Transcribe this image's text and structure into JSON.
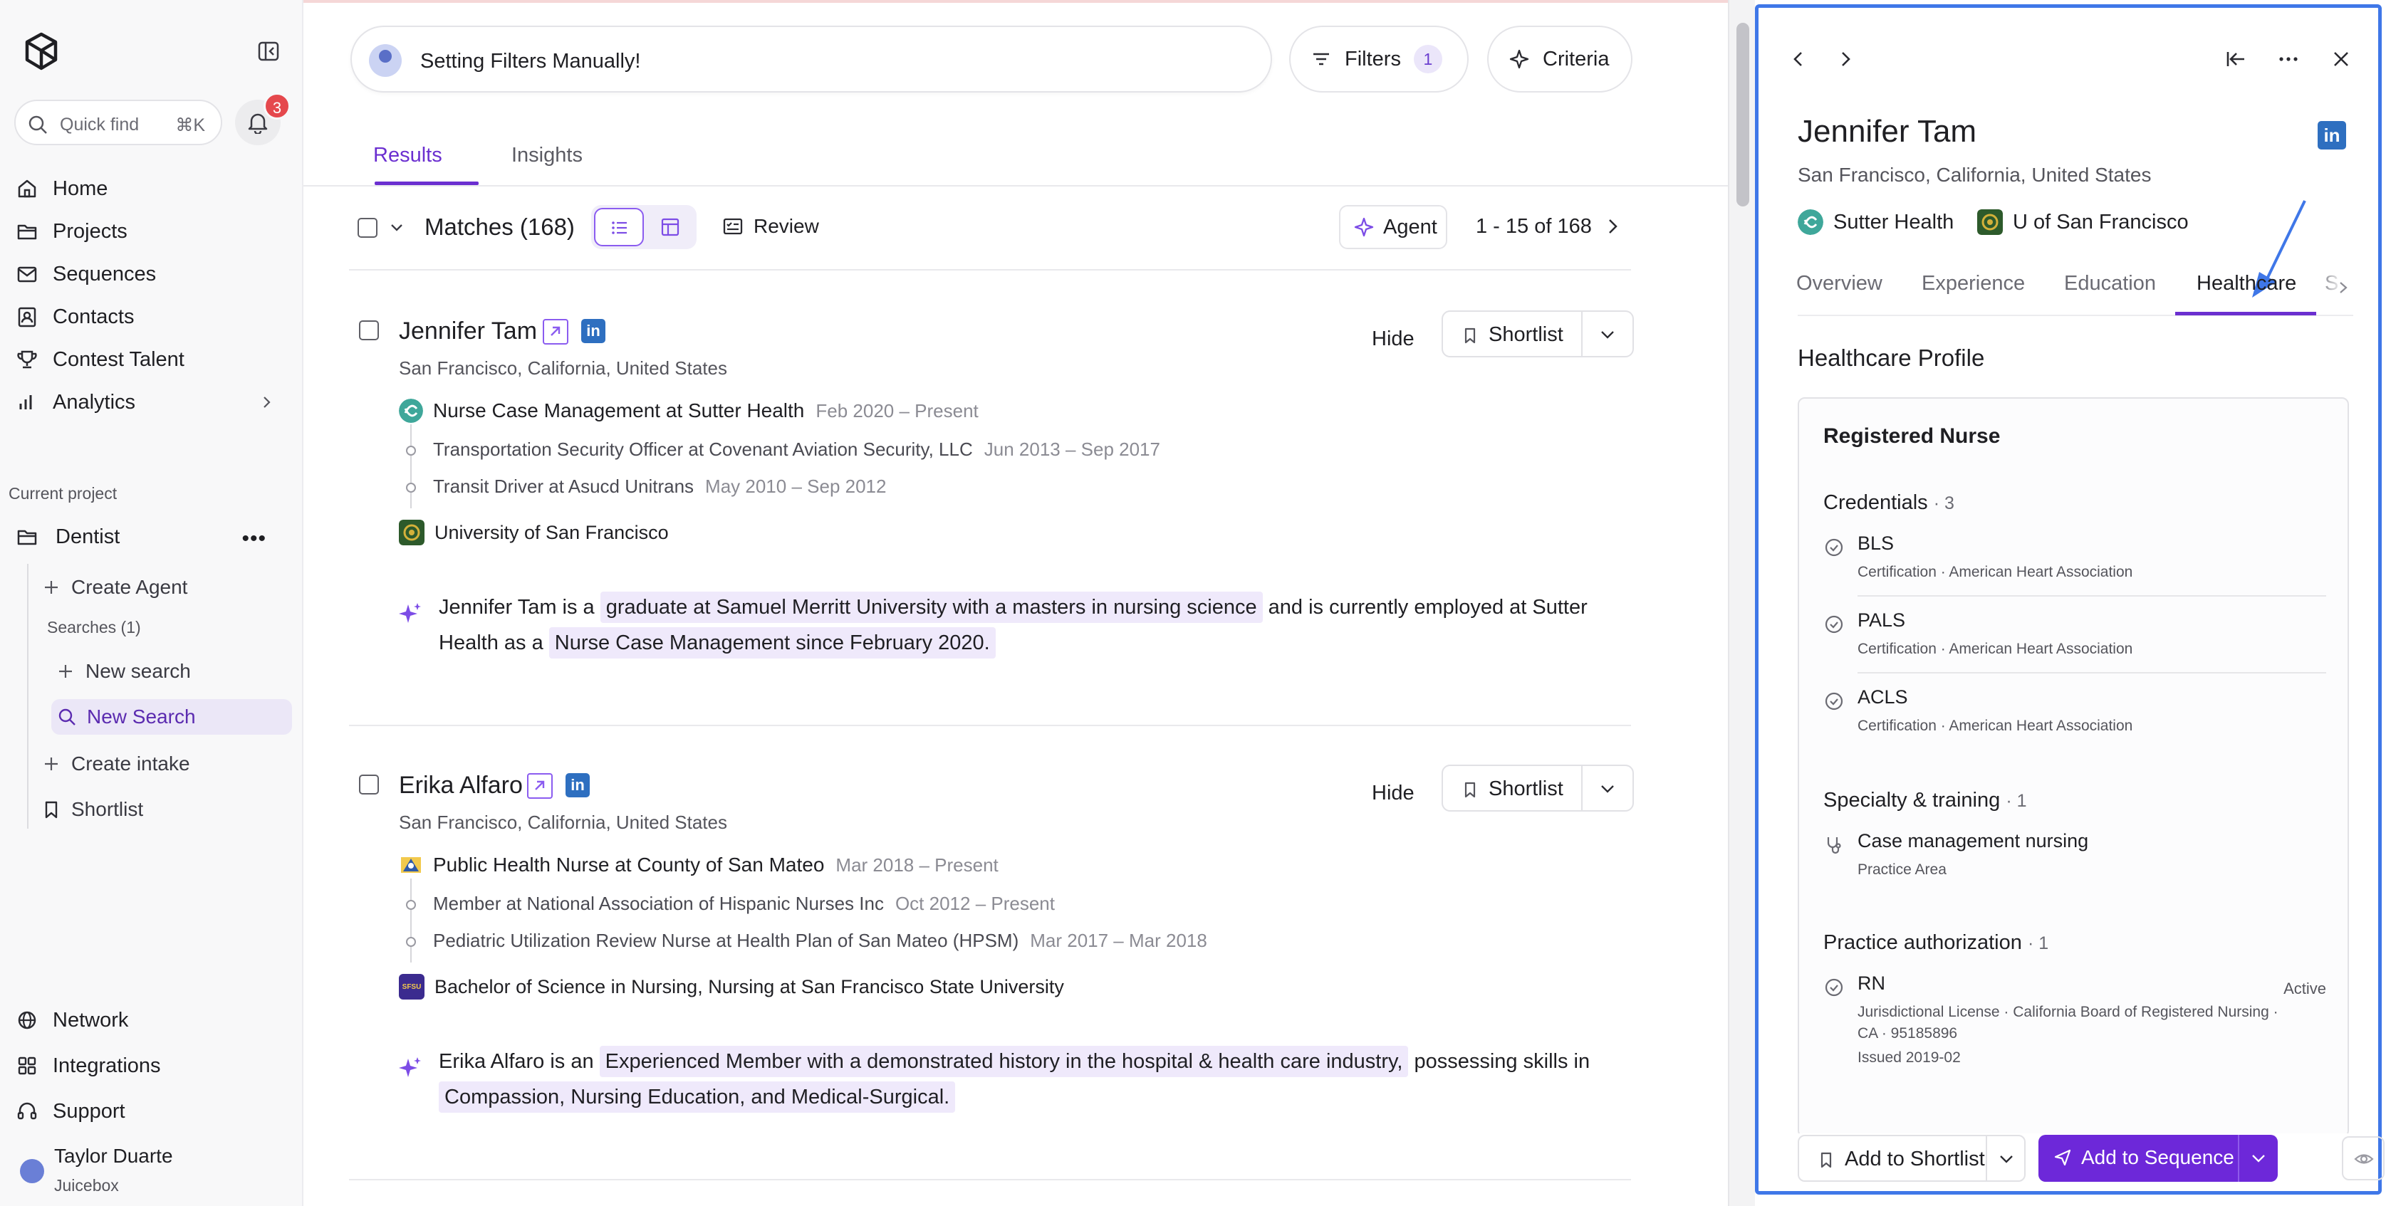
{
  "sidebar": {
    "quick_find": {
      "label": "Quick find",
      "shortcut": "⌘K"
    },
    "notifications": {
      "count": "3"
    },
    "nav": [
      {
        "label": "Home",
        "icon": "home-icon"
      },
      {
        "label": "Projects",
        "icon": "folder-icon"
      },
      {
        "label": "Sequences",
        "icon": "mail-icon"
      },
      {
        "label": "Contacts",
        "icon": "contacts-icon"
      },
      {
        "label": "Contest Talent",
        "icon": "trophy-icon"
      },
      {
        "label": "Analytics",
        "icon": "chart-icon"
      }
    ],
    "current_project_label": "Current project",
    "project_name": "Dentist",
    "create_agent": "Create Agent",
    "searches_label": "Searches (1)",
    "new_search_action": "New search",
    "new_search_item": "New Search",
    "create_intake": "Create intake",
    "shortlist": "Shortlist",
    "bottom_nav": [
      {
        "label": "Network",
        "icon": "globe-icon"
      },
      {
        "label": "Integrations",
        "icon": "grid-icon"
      },
      {
        "label": "Support",
        "icon": "headset-icon"
      }
    ],
    "user": {
      "name": "Taylor Duarte",
      "org": "Juicebox"
    }
  },
  "header": {
    "search_text": "Setting Filters Manually!",
    "filters_label": "Filters",
    "filters_count": "1",
    "criteria_label": "Criteria"
  },
  "tabs": [
    {
      "label": "Results"
    },
    {
      "label": "Insights"
    }
  ],
  "toolbar": {
    "matches": "Matches (168)",
    "review": "Review",
    "agent": "Agent",
    "pager": "1 - 15 of 168"
  },
  "results": [
    {
      "name": "Jennifer Tam",
      "location": "San Francisco, California, United States",
      "hide": "Hide",
      "shortlist": "Shortlist",
      "current_job": {
        "title": "Nurse Case Management at Sutter Health",
        "dates": "Feb 2020 – Present"
      },
      "past_jobs": [
        {
          "title": "Transportation Security Officer at Covenant Aviation Security, LLC",
          "dates": "Jun 2013 – Sep 2017"
        },
        {
          "title": "Transit Driver at Asucd Unitrans",
          "dates": "May 2010 – Sep 2012"
        }
      ],
      "education": "University of San Francisco",
      "summary": {
        "p1": "Jennifer Tam is a ",
        "h1": "graduate at Samuel Merritt University with a masters in nursing science",
        "p2": " and is currently employed at Sutter Health as a ",
        "h2": "Nurse Case Management since February 2020."
      }
    },
    {
      "name": "Erika Alfaro",
      "location": "San Francisco, California, United States",
      "hide": "Hide",
      "shortlist": "Shortlist",
      "current_job": {
        "title": "Public Health Nurse at County of San Mateo",
        "dates": "Mar 2018 – Present"
      },
      "past_jobs": [
        {
          "title": "Member at National Association of Hispanic Nurses Inc",
          "dates": "Oct 2012 – Present"
        },
        {
          "title": "Pediatric Utilization Review Nurse at Health Plan of San Mateo (HPSM)",
          "dates": "Mar 2017 – Mar 2018"
        }
      ],
      "education": "Bachelor of Science in Nursing, Nursing at San Francisco State University",
      "education_logo": "SFSU",
      "summary": {
        "p1": "Erika Alfaro is an ",
        "h1": "Experienced Member with a demonstrated history in the hospital & health care industry,",
        "p2": " possessing skills in ",
        "h2": "Compassion, Nursing Education, and Medical-Surgical."
      }
    }
  ],
  "panel": {
    "name": "Jennifer Tam",
    "location": "San Francisco, California, United States",
    "company": "Sutter Health",
    "school": "U of San Francisco",
    "tabs": [
      "Overview",
      "Experience",
      "Education",
      "Healthcare",
      "S"
    ],
    "active_tab": "Healthcare",
    "section_title": "Healthcare Profile",
    "role": "Registered Nurse",
    "credentials_label": "Credentials",
    "credentials_count": "· 3",
    "credentials": [
      {
        "name": "BLS",
        "detail": "Certification · American Heart Association"
      },
      {
        "name": "PALS",
        "detail": "Certification · American Heart Association"
      },
      {
        "name": "ACLS",
        "detail": "Certification · American Heart Association"
      }
    ],
    "specialty_label": "Specialty & training",
    "specialty_count": "· 1",
    "specialty": {
      "name": "Case management nursing",
      "detail": "Practice Area"
    },
    "auth_label": "Practice authorization",
    "auth_count": "· 1",
    "license": {
      "name": "RN",
      "status": "Active",
      "line1": "Jurisdictional License · California Board of Registered Nursing ·",
      "line2": "CA · 95185896",
      "line3": "Issued 2019-02"
    },
    "add_shortlist": "Add to Shortlist",
    "add_sequence": "Add to Sequence"
  },
  "colors": {
    "accent": "#6b2fd0",
    "highlight": "#efe9fb",
    "panel_border": "#3f77e8",
    "linkedin": "#2e6fc0"
  }
}
